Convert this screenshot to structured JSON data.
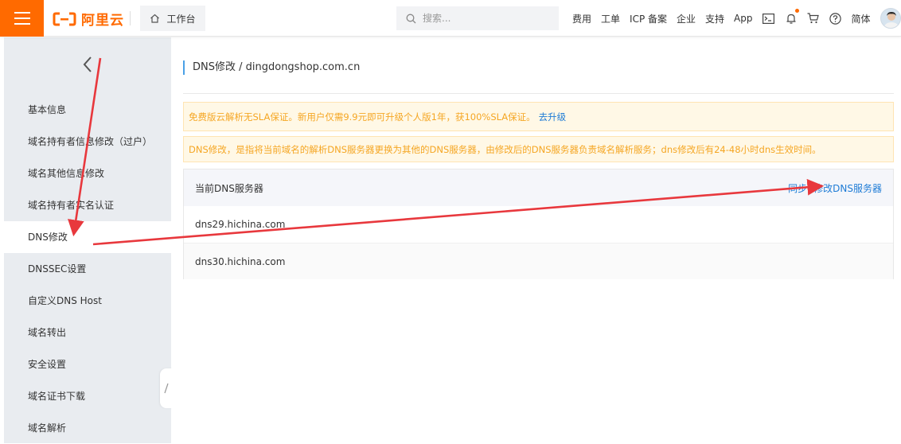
{
  "topbar": {
    "logo_text": "阿里云",
    "workbench_label": "工作台",
    "search_placeholder": "搜索...",
    "nav": [
      "费用",
      "工单",
      "ICP 备案",
      "企业",
      "支持",
      "App"
    ],
    "lang_label": "简体",
    "accent_color": "#ff6a00"
  },
  "sidebar": {
    "items": [
      {
        "label": "基本信息"
      },
      {
        "label": "域名持有者信息修改（过户）"
      },
      {
        "label": "域名其他信息修改"
      },
      {
        "label": "域名持有者实名认证"
      },
      {
        "label": "DNS修改",
        "active": true
      },
      {
        "label": "DNSSEC设置"
      },
      {
        "label": "自定义DNS Host"
      },
      {
        "label": "域名转出"
      },
      {
        "label": "安全设置"
      },
      {
        "label": "域名证书下载"
      },
      {
        "label": "域名解析"
      }
    ]
  },
  "main": {
    "breadcrumb": "DNS修改 / dingdongshop.com.cn",
    "notice1_text": "免费版云解析无SLA保证。新用户仅需9.9元即可升级个人版1年，获100%SLA保证。",
    "notice1_link": "去升级",
    "notice2_text": "DNS修改，是指将当前域名的解析DNS服务器更换为其他的DNS服务器，由修改后的DNS服务器负责域名解析服务；dns修改后有24-48小时dns生效时间。",
    "dns_header": "当前DNS服务器",
    "action_restore": "同步",
    "action_modify": "修改DNS服务器",
    "servers": [
      "dns29.hichina.com",
      "dns30.hichina.com"
    ]
  },
  "annotation": {
    "arrow_color": "#e8383d"
  }
}
